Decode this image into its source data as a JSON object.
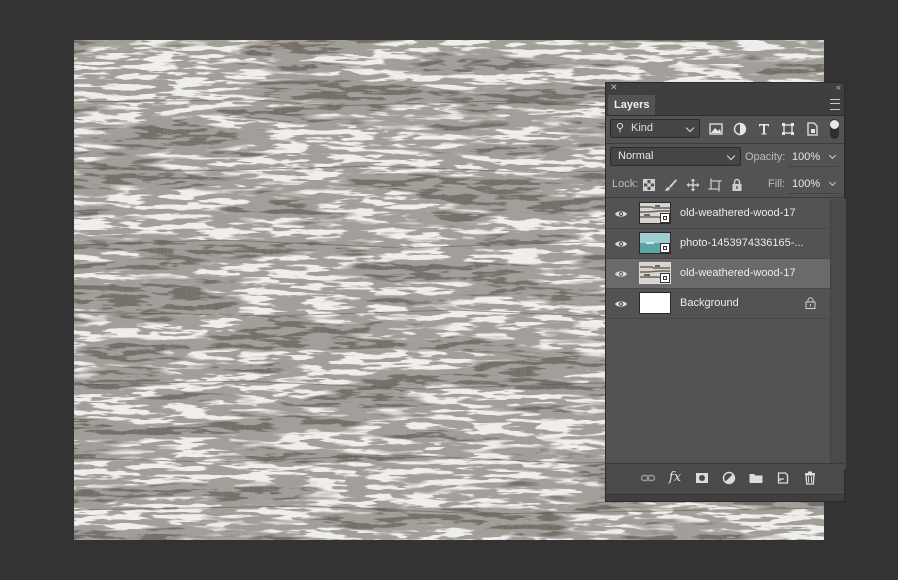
{
  "canvas": {
    "image_name": "old weathered wood texture"
  },
  "layers_panel": {
    "tab_label": "Layers",
    "filter": {
      "kind_label": "Kind",
      "icons": [
        "image-filter-icon",
        "adjustment-filter-icon",
        "type-filter-icon",
        "shape-filter-icon",
        "smart-object-filter-icon"
      ]
    },
    "blend_mode": "Normal",
    "opacity_label": "Opacity:",
    "opacity_value": "100%",
    "lock_label": "Lock:",
    "fill_label": "Fill:",
    "fill_value": "100%",
    "layers": [
      {
        "name": "old-weathered-wood-17",
        "visible": true,
        "selected": false,
        "smart_object": true,
        "thumb": "wood"
      },
      {
        "name": "photo-1453974336165-...",
        "visible": true,
        "selected": false,
        "smart_object": true,
        "thumb": "sea"
      },
      {
        "name": "old-weathered-wood-17",
        "visible": true,
        "selected": true,
        "smart_object": true,
        "thumb": "wood"
      },
      {
        "name": "Background",
        "visible": true,
        "selected": false,
        "smart_object": false,
        "locked": true,
        "thumb": "white"
      }
    ],
    "footer_buttons": [
      "link-layers",
      "fx",
      "add-mask",
      "adjustment-layer",
      "group",
      "new-layer",
      "delete-layer"
    ],
    "fx_label": "fx"
  },
  "colors": {
    "app_background": "#333333",
    "panel_background": "#535353",
    "selected_layer": "#6a6a6a"
  }
}
